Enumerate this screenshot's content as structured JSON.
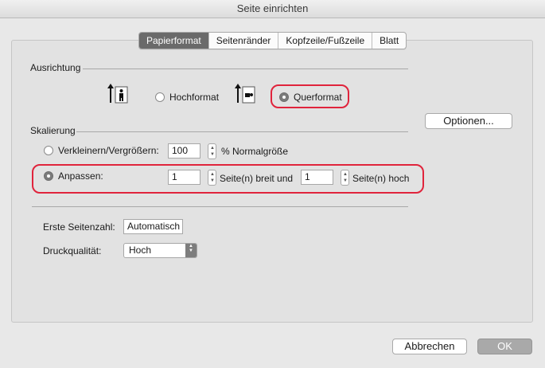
{
  "window": {
    "title": "Seite einrichten"
  },
  "tabs": [
    {
      "label": "Papierformat",
      "active": true
    },
    {
      "label": "Seitenränder",
      "active": false
    },
    {
      "label": "Kopfzeile/Fußzeile",
      "active": false
    },
    {
      "label": "Blatt",
      "active": false
    }
  ],
  "orientation": {
    "label": "Ausrichtung",
    "portrait_label": "Hochformat",
    "landscape_label": "Querformat",
    "selected": "Querformat"
  },
  "scaling": {
    "label": "Skalierung",
    "adjust_label": "Verkleinern/Vergrößern:",
    "adjust_value": "100",
    "adjust_suffix": "% Normalgröße",
    "fit_label": "Anpassen:",
    "fit_wide_value": "1",
    "fit_wide_suffix": "Seite(n) breit und",
    "fit_tall_value": "1",
    "fit_tall_suffix": "Seite(n) hoch",
    "selected": "Anpassen"
  },
  "options_button": "Optionen...",
  "first_page": {
    "label": "Erste Seitenzahl:",
    "value": "Automatisch"
  },
  "print_quality": {
    "label": "Druckqualität:",
    "value": "Hoch"
  },
  "footer": {
    "cancel_label": "Abbrechen",
    "ok_label": "OK"
  },
  "colors": {
    "highlight": "#e0243c",
    "active_tab": "#6a6a6a",
    "default_button": "#a9a9a9"
  }
}
